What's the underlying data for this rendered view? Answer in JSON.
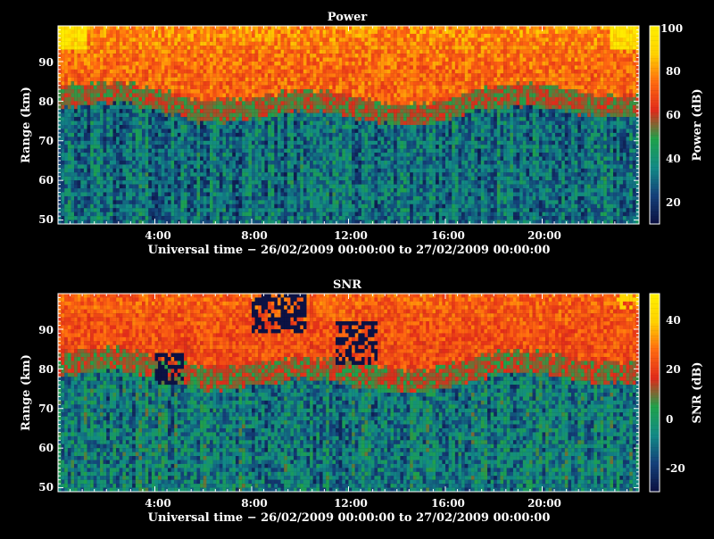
{
  "chart_data": [
    {
      "type": "heatmap",
      "title": "Power",
      "xlabel": "Universal time − 26/02/2009 00:00:00 to 27/02/2009 00:00:00",
      "ylabel": "Range (km)",
      "x_ticks": [
        "4:00",
        "8:00",
        "12:00",
        "16:00",
        "20:00"
      ],
      "x_range": [
        "00:00",
        "24:00"
      ],
      "y_ticks": [
        50,
        60,
        70,
        80,
        90
      ],
      "y_range": [
        49,
        99
      ],
      "colorbar": {
        "label": "Power (dB)",
        "ticks": [
          20,
          40,
          60,
          80,
          100
        ],
        "range": [
          10,
          100
        ]
      },
      "colormap": [
        "#0b0f40",
        "#14407a",
        "#128a86",
        "#1ea24a",
        "#e02a1a",
        "#ff6a10",
        "#ffd200",
        "#fff000"
      ],
      "data_summary": {
        "low_range_below_78km": "20-40 dB",
        "transition_78_85km": "45-55 dB",
        "high_range_above_85km": "60-80 dB"
      }
    },
    {
      "type": "heatmap",
      "title": "SNR",
      "xlabel": "Universal time − 26/02/2009 00:00:00 to 27/02/2009 00:00:00",
      "ylabel": "Range (km)",
      "x_ticks": [
        "4:00",
        "8:00",
        "12:00",
        "16:00",
        "20:00"
      ],
      "x_range": [
        "00:00",
        "24:00"
      ],
      "y_ticks": [
        50,
        60,
        70,
        80,
        90
      ],
      "y_range": [
        49,
        99
      ],
      "colorbar": {
        "label": "SNR (dB)",
        "ticks": [
          -20,
          0,
          20,
          40
        ],
        "range": [
          -30,
          50
        ]
      },
      "colormap": [
        "#0b0f40",
        "#14407a",
        "#128a86",
        "#1ea24a",
        "#e02a1a",
        "#ff6a10",
        "#ffd200",
        "#fff000"
      ],
      "data_summary": {
        "low_range_below_78km": "-20 to 0 dB",
        "transition_78_85km": "0-10 dB",
        "high_range_above_85km": "15-30 dB"
      }
    }
  ]
}
